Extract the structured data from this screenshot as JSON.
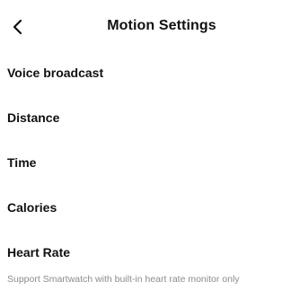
{
  "header": {
    "title": "Motion Settings",
    "back_icon": "chevron-left-icon"
  },
  "settings": {
    "items": [
      {
        "label": "Voice broadcast"
      },
      {
        "label": "Distance"
      },
      {
        "label": "Time"
      },
      {
        "label": "Calories"
      },
      {
        "label": "Heart Rate"
      }
    ],
    "hint": "Support Smartwatch with built-in heart rate monitor only"
  },
  "colors": {
    "text": "#111111",
    "hint": "#8c8c8c",
    "background": "#ffffff"
  }
}
